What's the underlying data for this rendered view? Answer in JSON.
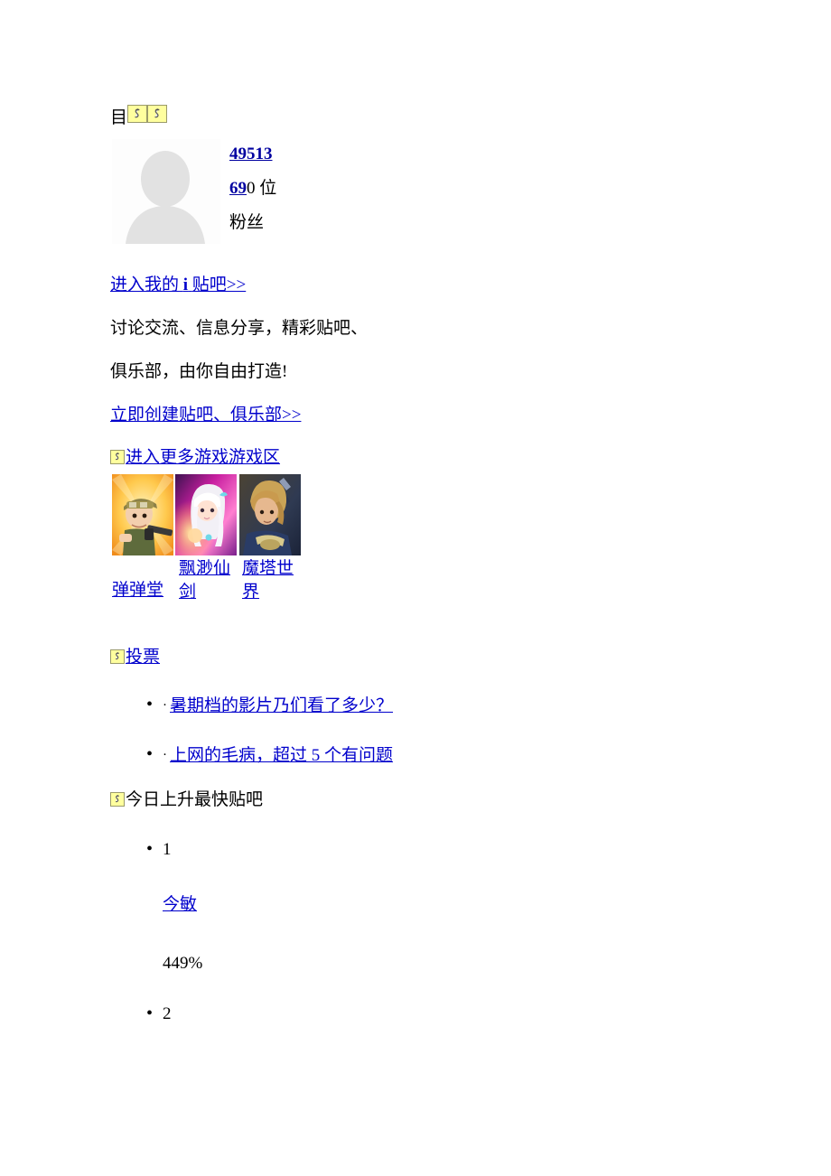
{
  "page": {
    "background": "#ffffff",
    "link_color": "#0000cc",
    "link_color_dark": "#0000a0",
    "text_color": "#000000",
    "broken_image_bg": "#ffff9e"
  },
  "top_row": {
    "label": "目",
    "icon1": "broken-image-icon",
    "icon2": "broken-image-icon"
  },
  "profile": {
    "avatar_icon": "default-avatar-silhouette",
    "post_count": "49513",
    "fans_count_link": "69",
    "fans_count_rest": "0 位",
    "fans_label": "粉丝"
  },
  "intro": {
    "enter_tieba_link": "进入我的 i 贴吧>>",
    "enter_tieba_link_pre": "进入我的",
    "enter_tieba_link_bold": "i",
    "enter_tieba_link_post": "贴吧>>",
    "desc_line1": "讨论交流、信息分享，精彩贴吧、",
    "desc_line2": "俱乐部，由你自由打造!",
    "create_link": "立即创建贴吧、俱乐部>>"
  },
  "games": {
    "header_icon": "broken-image-icon",
    "header_link": "进入更多游戏游戏区",
    "items": [
      {
        "label": "弹弹堂",
        "thumb": "game-thumb-soldier"
      },
      {
        "label": "飘渺仙剑",
        "thumb": "game-thumb-fairy"
      },
      {
        "label": "魔塔世界",
        "thumb": "game-thumb-warrior"
      }
    ]
  },
  "vote": {
    "header_icon": "broken-image-icon",
    "header_link": "投票",
    "items": [
      {
        "dot": "·",
        "label": "暑期档的影片乃们看了多少？"
      },
      {
        "dot": "·",
        "label": "上网的毛病，超过 5 个有问题"
      }
    ]
  },
  "rising": {
    "header_icon": "broken-image-icon",
    "header_title": "今日上升最快贴吧",
    "entries": [
      {
        "rank": "1",
        "name": "今敏",
        "percent": "449%"
      },
      {
        "rank": "2",
        "name": "",
        "percent": ""
      }
    ]
  }
}
